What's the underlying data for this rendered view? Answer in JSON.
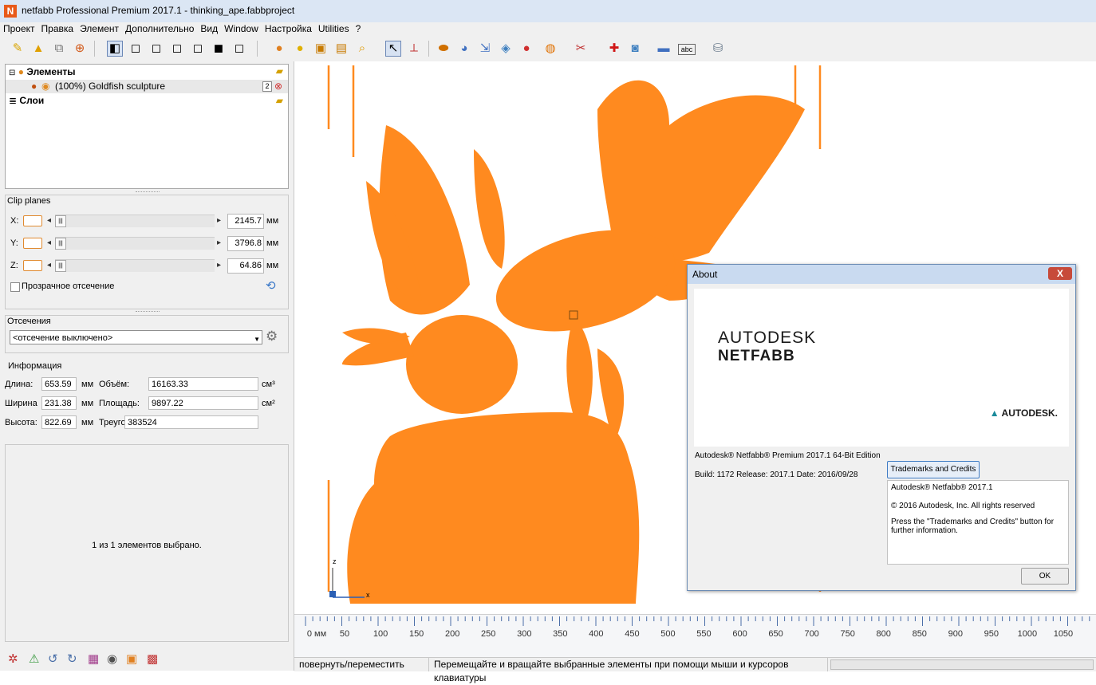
{
  "window": {
    "title": "netfabb Professional Premium 2017.1 - thinking_ape.fabbproject",
    "app_icon": "N"
  },
  "menu": [
    "Проект",
    "Правка",
    "Элемент",
    "Дополнительно",
    "Вид",
    "Window",
    "Настройка",
    "Utilities",
    "?"
  ],
  "toolbar": {
    "icons": [
      "open-project-icon",
      "add-part-icon",
      "import-icon",
      "add-icon",
      "view-front-icon",
      "view-back-icon",
      "view-left-icon",
      "view-right-icon",
      "view-top-icon",
      "view-bottom-icon",
      "view-iso-icon",
      "shade-icon",
      "color-icon",
      "box-icon",
      "slice-icon",
      "zoom-icon",
      "select-icon",
      "measure-axis-icon",
      "move-icon",
      "rotate-icon",
      "scale-icon",
      "mesh-icon",
      "boolean-icon",
      "analysis-icon",
      "cut-icon",
      "repair-icon",
      "support-icon",
      "ruler-icon",
      "label-icon",
      "stamp-icon"
    ]
  },
  "tree": {
    "elements_label": "Элементы",
    "part_label": "(100%) Goldfish sculpture",
    "part_badge": "2",
    "layers_label": "Слои"
  },
  "clip_planes": {
    "title": "Clip planes",
    "axes": [
      {
        "axis": "X:",
        "value": "2145.7",
        "unit": "мм"
      },
      {
        "axis": "Y:",
        "value": "3796.8",
        "unit": "мм"
      },
      {
        "axis": "Z:",
        "value": "64.86",
        "unit": "мм"
      }
    ],
    "transparent_label": "Прозрачное отсечение"
  },
  "cuts": {
    "title": "Отсечения",
    "selected": "<отсечение выключено>"
  },
  "info": {
    "title": "Информация",
    "length_label": "Длина:",
    "length_value": "653.59",
    "length_unit": "мм",
    "width_label": "Ширина",
    "width_value": "231.38",
    "width_unit": "мм",
    "height_label": "Высота:",
    "height_value": "822.69",
    "height_unit": "мм",
    "volume_label": "Объём:",
    "volume_value": "16163.33",
    "volume_unit": "см³",
    "area_label": "Площадь:",
    "area_value": "9897.22",
    "area_unit": "см²",
    "triangles_label": "Треугольни",
    "triangles_value": "383524"
  },
  "selection_message": "1 из 1 элементов выбрано.",
  "bottom_icons": [
    "repair-icon",
    "warning-icon",
    "rotate-left-icon",
    "rotate-right-icon",
    "layer-icon",
    "toggle-icon",
    "frame-icon",
    "grid-icon"
  ],
  "ruler": {
    "labels": [
      "0 мм",
      "50",
      "100",
      "150",
      "200",
      "250",
      "300",
      "350",
      "400",
      "450",
      "500",
      "550",
      "600",
      "650",
      "700",
      "750",
      "800",
      "850",
      "900",
      "950",
      "1000",
      "1050"
    ]
  },
  "axis_gizmo": {
    "z": "z",
    "x": "x"
  },
  "status": {
    "mode": "повернуть/переместить",
    "hint": "Перемещайте и вращайте выбранные элементы при помощи мыши и курсоров клавиатуры"
  },
  "about": {
    "title": "About",
    "close": "X",
    "brand_line1": "AUTODESK",
    "brand_line2": "NETFABB",
    "brand_mark": "AUTODESK.",
    "edition": "Autodesk® Netfabb® Premium 2017.1 64-Bit Edition",
    "build": "Build: 1172 Release: 2017.1 Date: 2016/09/28",
    "trademarks_button": "Trademarks and Credits",
    "info_line1": "Autodesk® Netfabb® 2017.1",
    "info_line2": "© 2016 Autodesk, Inc. All rights reserved",
    "info_line3": "Press the \"Trademarks and Credits\" button for further information.",
    "ok": "OK"
  },
  "colors": {
    "model": "#ff8a1f",
    "accent": "#3f7cc4",
    "frame": "#dbe6f4"
  }
}
